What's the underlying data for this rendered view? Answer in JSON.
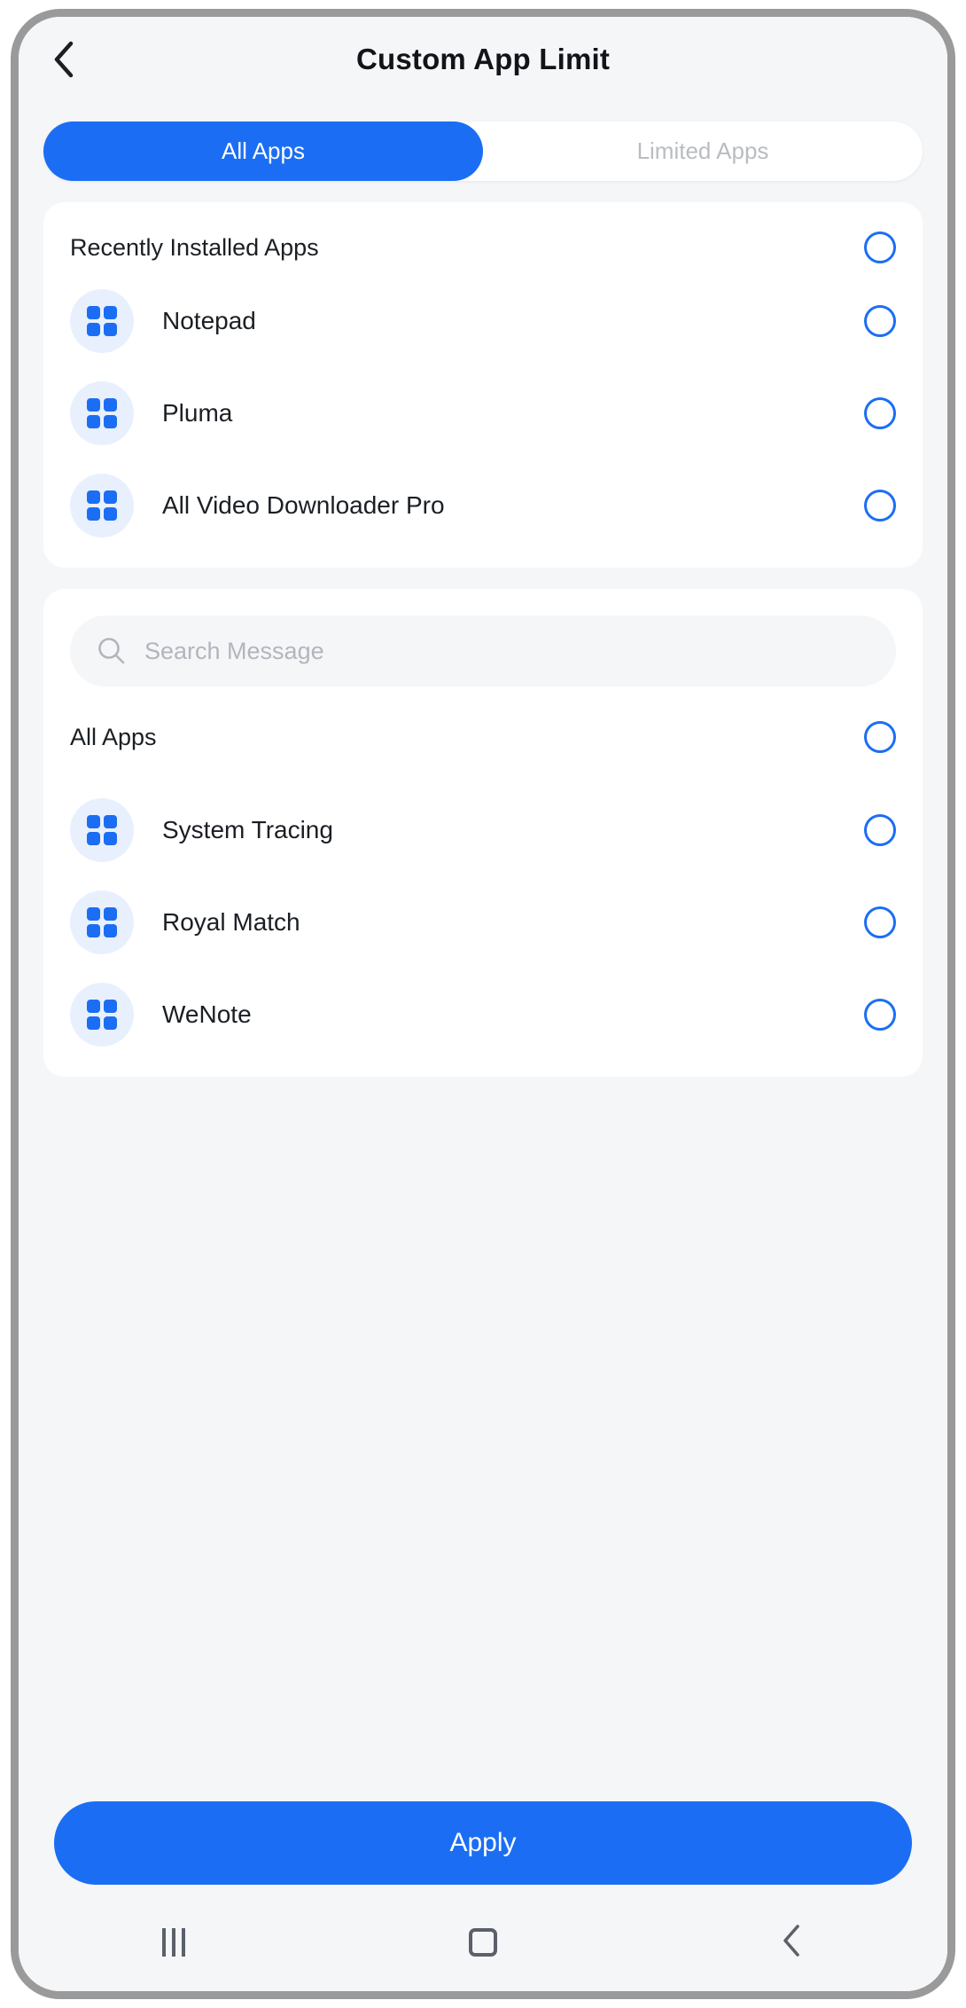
{
  "header": {
    "back_icon": "chevron-left-icon",
    "title": "Custom App Limit"
  },
  "tabs": [
    {
      "label": "All Apps",
      "active": true
    },
    {
      "label": "Limited Apps",
      "active": false
    }
  ],
  "recent_card": {
    "section_title": "Recently Installed Apps",
    "section_radio_selected": false,
    "apps": [
      {
        "name": "Notepad",
        "icon": "app-grid-icon",
        "selected": false
      },
      {
        "name": "Pluma",
        "icon": "app-grid-icon",
        "selected": false
      },
      {
        "name": "All Video Downloader Pro",
        "icon": "app-grid-icon",
        "selected": false
      }
    ]
  },
  "all_card": {
    "search": {
      "icon": "search-icon",
      "value": "",
      "placeholder": "Search Message"
    },
    "section_title": "All Apps",
    "section_radio_selected": false,
    "apps": [
      {
        "name": "System Tracing",
        "icon": "app-grid-icon",
        "selected": false
      },
      {
        "name": "Royal Match",
        "icon": "app-grid-icon",
        "selected": false
      },
      {
        "name": "WeNote",
        "icon": "app-grid-icon",
        "selected": false
      }
    ]
  },
  "footer": {
    "apply_label": "Apply"
  },
  "navbar": {
    "recents_icon": "recents-icon",
    "home_icon": "home-square-icon",
    "back_icon": "chevron-left-icon"
  },
  "colors": {
    "accent": "#1b6ef3",
    "screen_bg": "#f5f6f8",
    "card_bg": "#ffffff",
    "icon_bg": "#e9f0fd",
    "text": "#1b1f24",
    "muted": "#b9bcc2"
  }
}
